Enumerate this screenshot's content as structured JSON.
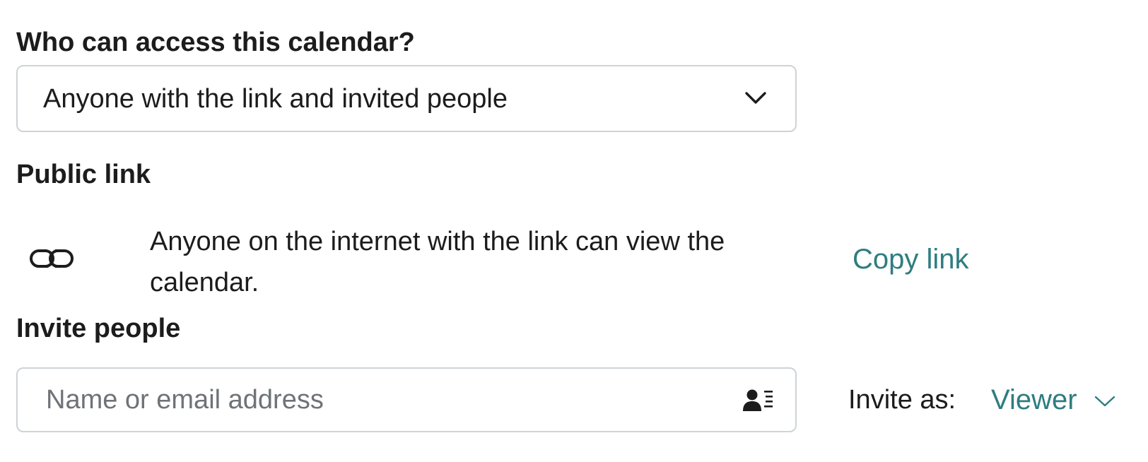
{
  "access": {
    "heading": "Who can access this calendar?",
    "selected": "Anyone with the link and invited people",
    "chevron_icon": "chevron-down-icon"
  },
  "public_link": {
    "heading": "Public link",
    "icon": "link-icon",
    "description": "Anyone on the internet with the link can view the calendar.",
    "copy_label": "Copy link"
  },
  "invite": {
    "heading": "Invite people",
    "placeholder": "Name or email address",
    "value": "",
    "contacts_icon": "contacts-icon",
    "invite_as_label": "Invite as:",
    "role": "Viewer",
    "role_chevron_icon": "chevron-down-icon"
  },
  "colors": {
    "accent": "#2f7d80",
    "text": "#1c1c1c",
    "border": "#cfd3d6",
    "placeholder": "#6f7377"
  }
}
